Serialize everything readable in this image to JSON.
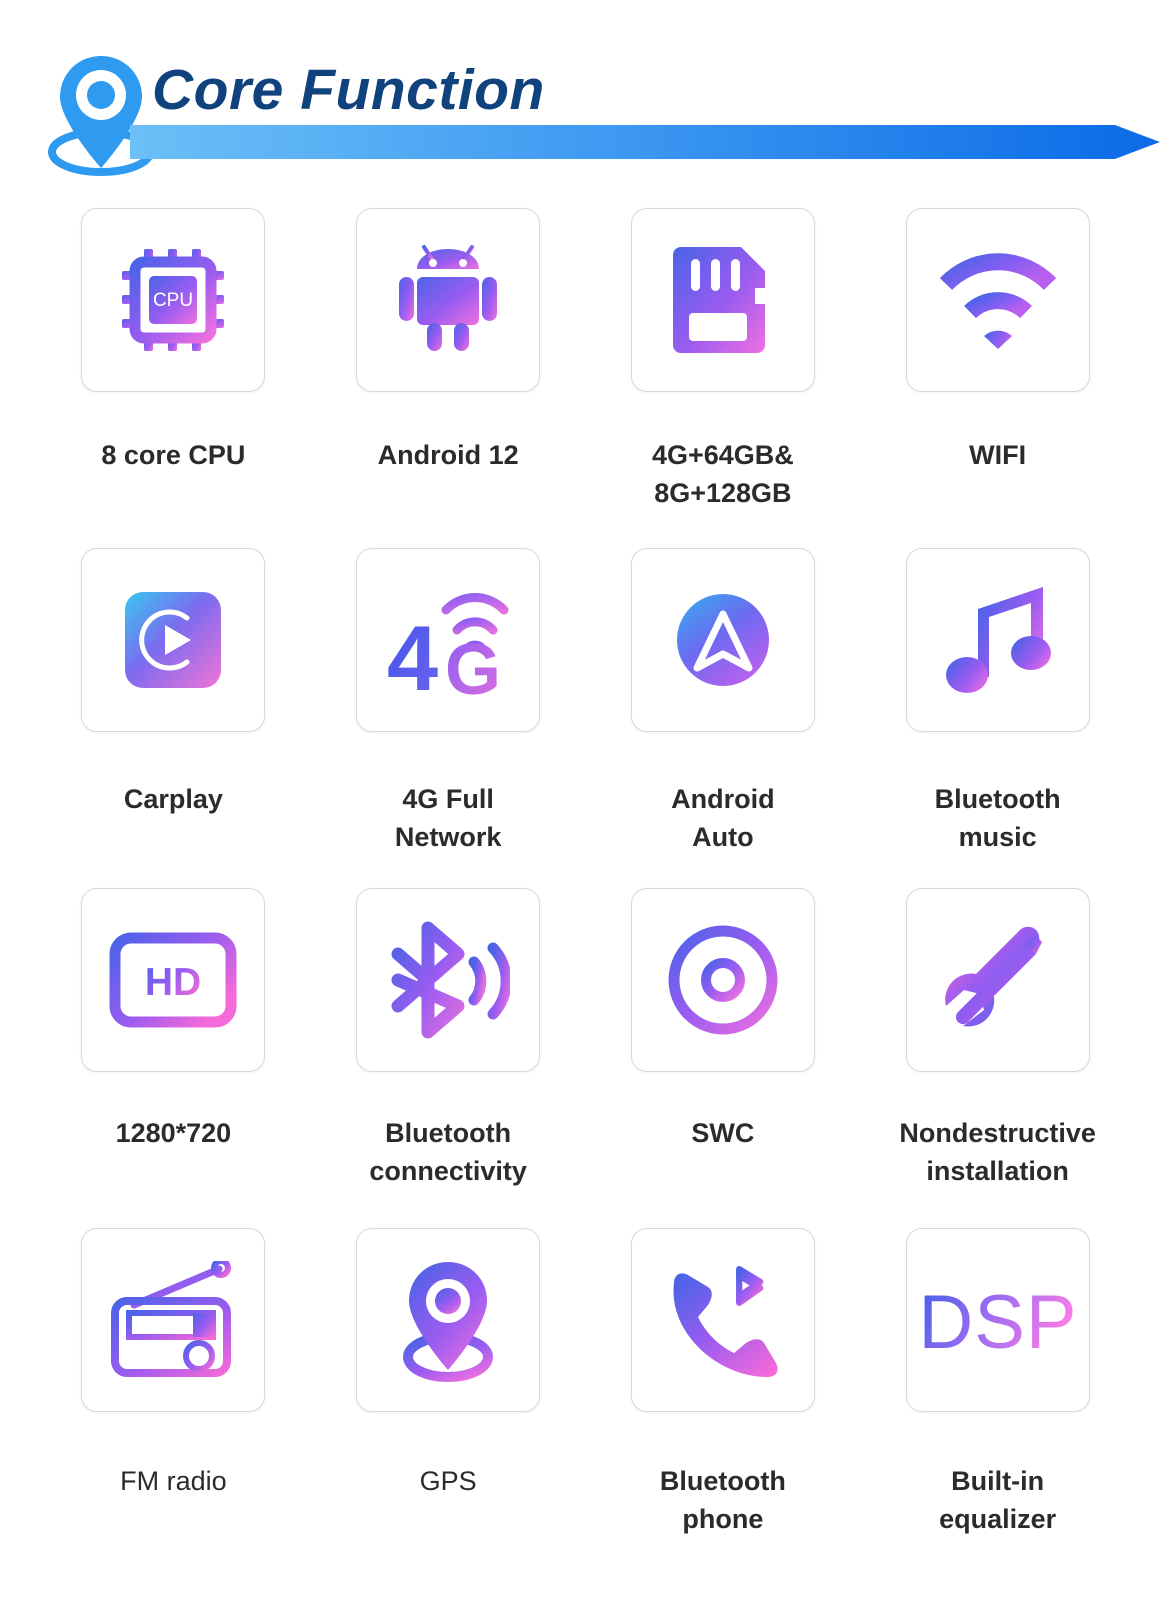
{
  "header": {
    "title": "Core Function",
    "pin_icon": "location-pin-icon",
    "title_color": "#10427e",
    "bar_gradient_start": "#5fb8f5",
    "bar_gradient_end": "#0f6fe8"
  },
  "theme": {
    "icon_gradient_start": "#4a63e8",
    "icon_gradient_mid": "#9a5cf0",
    "icon_gradient_end": "#f070e0",
    "card_border": "#d7d9de",
    "label_color": "#2b2b2e",
    "background": "#ffffff"
  },
  "features": [
    {
      "icon": "cpu-chip-icon",
      "label": "8 core CPU",
      "bold": true
    },
    {
      "icon": "android-robot-icon",
      "label": "Android 12",
      "bold": true
    },
    {
      "icon": "sd-memory-card-icon",
      "label": "4G+64GB&\n8G+128GB",
      "bold": true
    },
    {
      "icon": "wifi-icon",
      "label": "WIFI",
      "bold": true
    },
    {
      "icon": "carplay-icon",
      "label": "Carplay",
      "bold": true
    },
    {
      "icon": "4g-network-icon",
      "label": "4G Full\nNetwork",
      "bold": true
    },
    {
      "icon": "android-auto-icon",
      "label": "Android\nAuto",
      "bold": true
    },
    {
      "icon": "music-note-icon",
      "label": "Bluetooth\nmusic",
      "bold": true
    },
    {
      "icon": "hd-screen-icon",
      "label": "1280*720",
      "bold": true
    },
    {
      "icon": "bluetooth-signal-icon",
      "label": "Bluetooth\nconnectivity",
      "bold": true
    },
    {
      "icon": "steering-wheel-icon",
      "label": "SWC",
      "bold": true
    },
    {
      "icon": "wrench-screwdriver-icon",
      "label": "Nondestructive\ninstallation",
      "bold": true
    },
    {
      "icon": "fm-radio-icon",
      "label": "FM radio",
      "bold": false
    },
    {
      "icon": "gps-pin-icon",
      "label": "GPS",
      "bold": false
    },
    {
      "icon": "bluetooth-phone-icon",
      "label": "Bluetooth\nphone",
      "bold": true
    },
    {
      "icon": "dsp-text-icon",
      "label": "Built-in\nequalizer",
      "bold": true
    }
  ]
}
